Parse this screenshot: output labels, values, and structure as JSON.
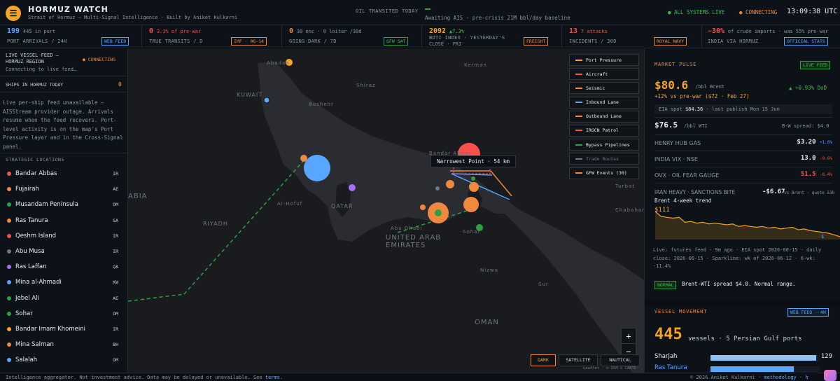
{
  "header": {
    "title": "HORMUZ WATCH",
    "subtitle": "Strait of Hormuz — Multi-Signal Intelligence · Built by Aniket Kulkarni",
    "oil_label": "OIL TRANSITED TODAY",
    "oil_status": "Awaiting AIS · pre-crisis 21M bbl/day baseline",
    "system_status": "● ALL SYSTEMS LIVE",
    "connection_status": "● CONNECTING",
    "clock": "13:09:38 UTC"
  },
  "kpis": [
    {
      "value": "199",
      "unit": "445 in port",
      "label": "PORT ARRIVALS / 24H",
      "badge": "WEB FEED",
      "color": "#58a6ff"
    },
    {
      "value": "0",
      "unit": "3.1% of pre-war",
      "label": "TRUE TRANSITS / D",
      "badge": "IMF · 06-14",
      "color": "#f85149"
    },
    {
      "value": "0",
      "unit": "30 enc · 0 loiter /30d",
      "label": "GOING-DARK / 7D",
      "badge": "GFW SAT",
      "color": "#f0883e"
    },
    {
      "value": "2092",
      "unit": "▲7.3%",
      "label": "BDTI INDEX · YESTERDAY'S",
      "label2": "CLOSE · FRI",
      "badge": "FREIGHT",
      "color": "#f5a524"
    },
    {
      "value": "13",
      "unit": "7 attacks",
      "label": "INCIDENTS / 30D",
      "badge": "ROYAL NAVY",
      "color": "#f85149"
    },
    {
      "value": "~30%",
      "unit": "of crude imports · was 55% pre-war",
      "label": "INDIA VIA HORMUZ",
      "badge": "OFFICIAL STATS",
      "color": "#f85149"
    }
  ],
  "sidebar": {
    "feed_title_1": "LIVE VESSEL FEED —",
    "feed_title_2": "HORMUZ REGION",
    "feed_status": "● CONNECTING",
    "feed_sub": "Connecting to live feed…",
    "ships_label": "SHIPS IN HORMUZ TODAY",
    "ships_value": "0",
    "unavailable_text": "Live per-ship feed unavailable — AISStream provider outage. Arrivals resume when the feed recovers. Port-level activity is on the map's Port Pressure layer and in the Cross-Signal panel.",
    "locations_title": "STRATEGIC LOCATIONS",
    "locations": [
      {
        "name": "Bandar Abbas",
        "code": "IR",
        "color": "#f85149"
      },
      {
        "name": "Fujairah",
        "code": "AE",
        "color": "#f0883e"
      },
      {
        "name": "Musandam Peninsula",
        "code": "OM",
        "color": "#2ea043"
      },
      {
        "name": "Ras Tanura",
        "code": "SA",
        "color": "#f0883e"
      },
      {
        "name": "Qeshm Island",
        "code": "IR",
        "color": "#f85149"
      },
      {
        "name": "Abu Musa",
        "code": "IR",
        "color": "#6e7681"
      },
      {
        "name": "Ras Laffan",
        "code": "QA",
        "color": "#a371f7"
      },
      {
        "name": "Mina al-Ahmadi",
        "code": "KW",
        "color": "#58a6ff"
      },
      {
        "name": "Jebel Ali",
        "code": "AE",
        "color": "#2ea043"
      },
      {
        "name": "Sohar",
        "code": "OM",
        "color": "#2ea043"
      },
      {
        "name": "Bandar Imam Khomeini",
        "code": "IR",
        "color": "#f5a524"
      },
      {
        "name": "Mina Salman",
        "code": "BH",
        "color": "#f0883e"
      },
      {
        "name": "Salalah",
        "code": "OM",
        "color": "#58a6ff"
      }
    ]
  },
  "map": {
    "labels": [
      "Abadan",
      "KUWAIT",
      "Bushehr",
      "Kerman",
      "Shiraz",
      "Bandar Abbas",
      "Turbat",
      "Chabahar",
      "Al-Hofuf",
      "QATAR",
      "RIYADH",
      "ABIA",
      "UNITED ARAB EMIRATES",
      "Abu Dhabi",
      "Sohar",
      "Nizwa",
      "OMAN",
      "Sur"
    ],
    "tooltip": "Narrowest Point · 54 km",
    "legend": [
      {
        "label": "Port Pressure",
        "color": "#f5a524",
        "dim": false
      },
      {
        "label": "Aircraft",
        "color": "#f85149",
        "dim": false
      },
      {
        "label": "Seismic",
        "color": "#f0883e",
        "dim": false
      },
      {
        "label": "Inbound Lane",
        "color": "#58a6ff",
        "dim": false
      },
      {
        "label": "Outbound Lane",
        "color": "#f0883e",
        "dim": false
      },
      {
        "label": "IRGCN Patrol",
        "color": "#f85149",
        "dim": false
      },
      {
        "label": "Bypass Pipelines",
        "color": "#2ea043",
        "dim": false
      },
      {
        "label": "Trade Routes",
        "color": "#6e7681",
        "dim": true
      },
      {
        "label": "GFW Events (30)",
        "color": "#f0883e",
        "dim": false
      }
    ],
    "zoom_in": "+",
    "zoom_out": "−",
    "styles": [
      "DARK",
      "SATELLITE",
      "NAUTICAL"
    ],
    "attribution": "Leaflet · © OSM © CARTO"
  },
  "market": {
    "title": "MARKET PULSE",
    "badge": "LIVE FEED",
    "brent_value": "$80.6",
    "brent_unit": "/bbl Brent",
    "brent_dod": "▲ +0.93% DoD",
    "brent_pre": "+12% vs pre-war ($72 · Feb 27)",
    "eia_label": "EIA spot",
    "eia_value": "$84.36",
    "eia_note": "· last publish Mon 15 Jun",
    "wti_value": "$76.5",
    "wti_unit": "/bbl WTI",
    "bw_spread": "B-W spread: $4.0",
    "rows": [
      {
        "name": "HENRY HUB GAS",
        "value": "$3.20",
        "change": "+1.6%",
        "color": "#e6edf3",
        "change_color": "#58a6ff"
      },
      {
        "name": "INDIA VIX · NSE",
        "value": "13.0",
        "change": "-9.6%",
        "color": "#e6edf3",
        "change_color": "#f85149"
      },
      {
        "name": "OVX · OIL FEAR GAUGE",
        "value": "51.5",
        "change": "-8.4%",
        "color": "#f85149",
        "change_color": "#f85149"
      }
    ],
    "iran_label": "IRAN HEAVY · SANCTIONS BITE",
    "iran_value": "-$6.67",
    "iran_note": "vs Brent · quote 53h",
    "trend_label": "Brent 4-week trend",
    "trend_high": "$111",
    "trend_low": "$",
    "trend_values": [
      111,
      105,
      104,
      103,
      104,
      98,
      99,
      97,
      98,
      96,
      97,
      96,
      95,
      96,
      93,
      94,
      93,
      92,
      93,
      91,
      92,
      90,
      91,
      92,
      89,
      90,
      88,
      87,
      86,
      85,
      83,
      80.6
    ],
    "live_note": "Live: futures feed · 9m ago · EIA spot 2026-06-15 · daily close: 2026-06-15 · Sparkline: wk of 2026-06-12 · 6-wk: -11.4%",
    "normal_badge": "NORMAL",
    "normal_text": "Brent-WTI spread $4.0. Normal range."
  },
  "vessel": {
    "title": "VESSEL MOVEMENT",
    "badge": "WEB FEED · 4H",
    "count": "445",
    "count_text": "vessels · 5 Persian Gulf ports",
    "ports": [
      {
        "name": "Sharjah",
        "value": "129",
        "fraction": 0.97,
        "color": "#8fc3f5",
        "name_color": "#e6edf3"
      },
      {
        "name": "Ras Tanura",
        "value": "",
        "fraction": 0.76,
        "color": "#58a6ff",
        "name_color": "#58a6ff"
      }
    ]
  },
  "footer": {
    "left": "Intelligence aggregator. Not investment advice. Data may be delayed or unavailable. See",
    "terms": "terms.",
    "right": "© 2026 Aniket Kulkarni · ",
    "methodology": "methodology",
    "sep": " · ",
    "more": "h"
  }
}
